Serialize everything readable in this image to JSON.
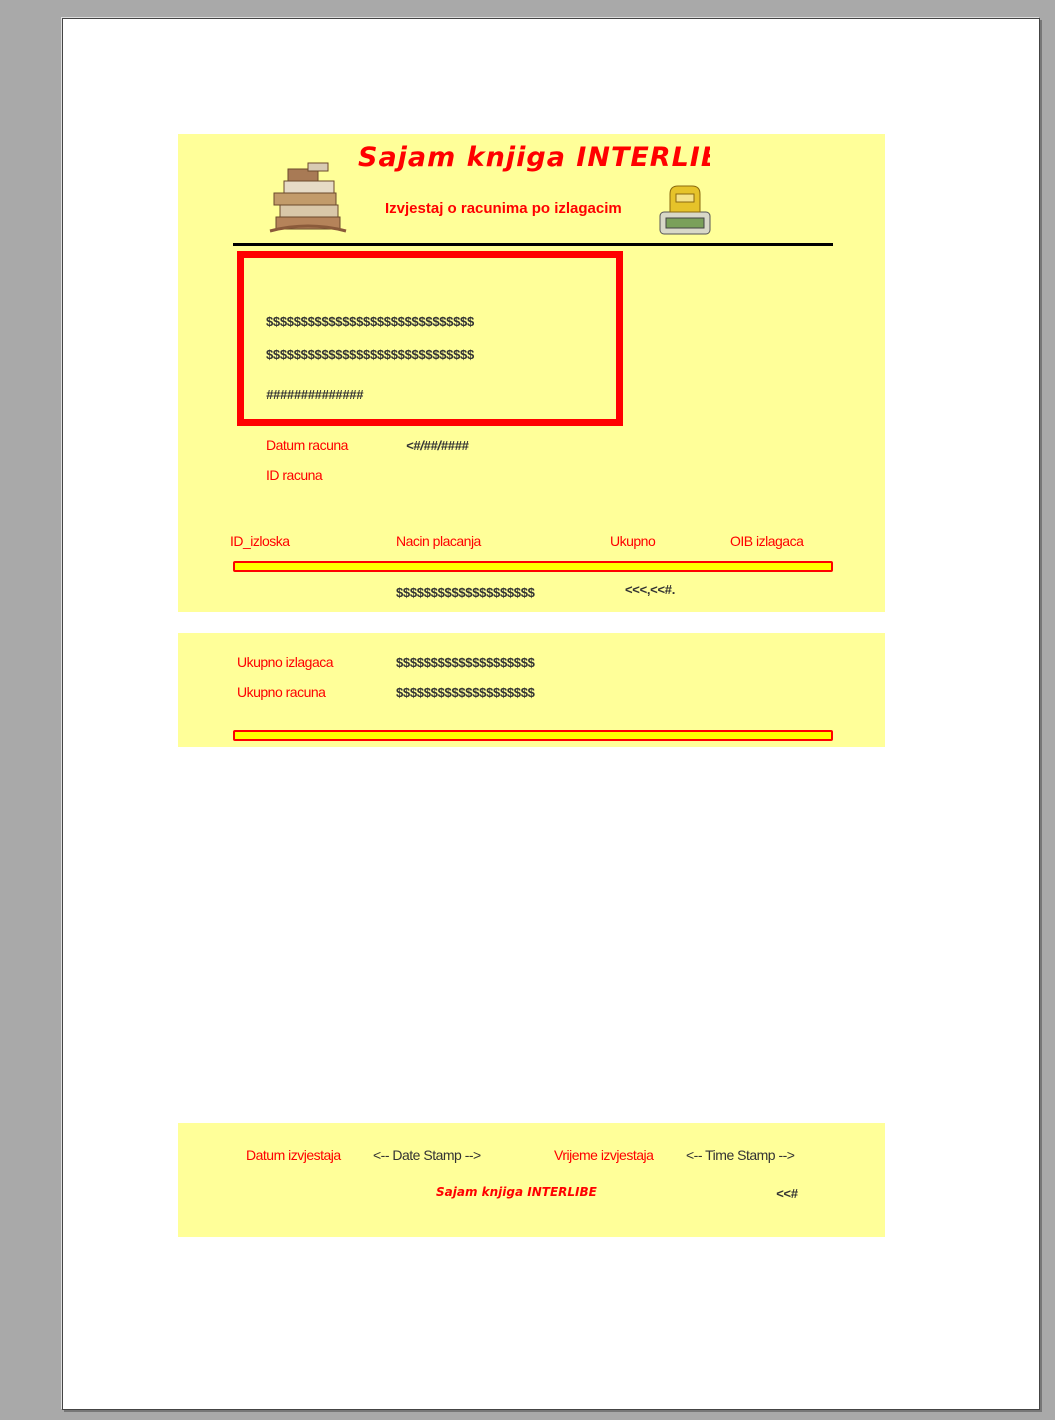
{
  "header": {
    "title": "Sajam knjiga INTERLIBEF",
    "subtitle": "Izvjestaj o racunima po izlagacim",
    "books_icon": "books-stack-icon",
    "cash_register_icon": "cash-register-icon"
  },
  "info_box": {
    "line1": "$$$$$$$$$$$$$$$$$$$$$$$$$$$$$$",
    "line2": "$$$$$$$$$$$$$$$$$$$$$$$$$$$$$$",
    "line3": "##############"
  },
  "detail": {
    "datum_label": "Datum racuna",
    "datum_value": "<#/##/####",
    "id_label": "ID racuna"
  },
  "columns": {
    "id_izloska": "ID_izloska",
    "nacin_placanja": "Nacin placanja",
    "ukupno": "Ukupno",
    "oib": "OIB izlagaca"
  },
  "row": {
    "nacin_value": "$$$$$$$$$$$$$$$$$$$$",
    "ukupno_value": "<<<,<<#."
  },
  "summary": {
    "izlagaca_label": "Ukupno izlagaca",
    "izlagaca_value": "$$$$$$$$$$$$$$$$$$$$",
    "racuna_label": "Ukupno racuna",
    "racuna_value": "$$$$$$$$$$$$$$$$$$$$"
  },
  "footer": {
    "datum_label": "Datum izvjestaja",
    "date_stamp": "<-- Date Stamp -->",
    "vrijeme_label": "Vrijeme izvjestaja",
    "time_stamp": "<-- Time Stamp -->",
    "title": "Sajam knjiga INTERLIBE",
    "page_num": "<<#"
  },
  "colors": {
    "band": "#ffff99",
    "accent": "#ff0000",
    "bar_fill": "#ffff00"
  }
}
